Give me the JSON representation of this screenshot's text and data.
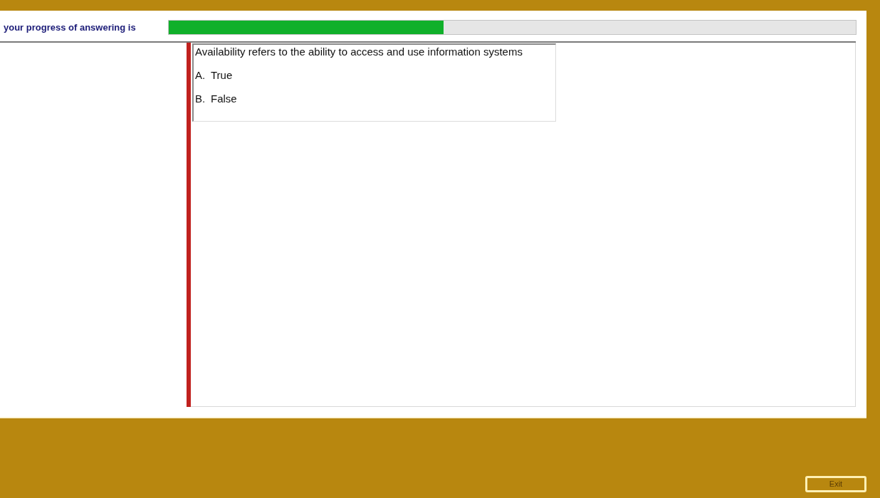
{
  "progress": {
    "label": "your progress of answering is",
    "level": 0.4
  },
  "question": {
    "text": "Availability refers to the ability to access and use information systems",
    "options": [
      {
        "letter": "A.",
        "text": "True"
      },
      {
        "letter": "B.",
        "text": "False"
      }
    ]
  },
  "exit_button": {
    "label": "Exit"
  }
}
